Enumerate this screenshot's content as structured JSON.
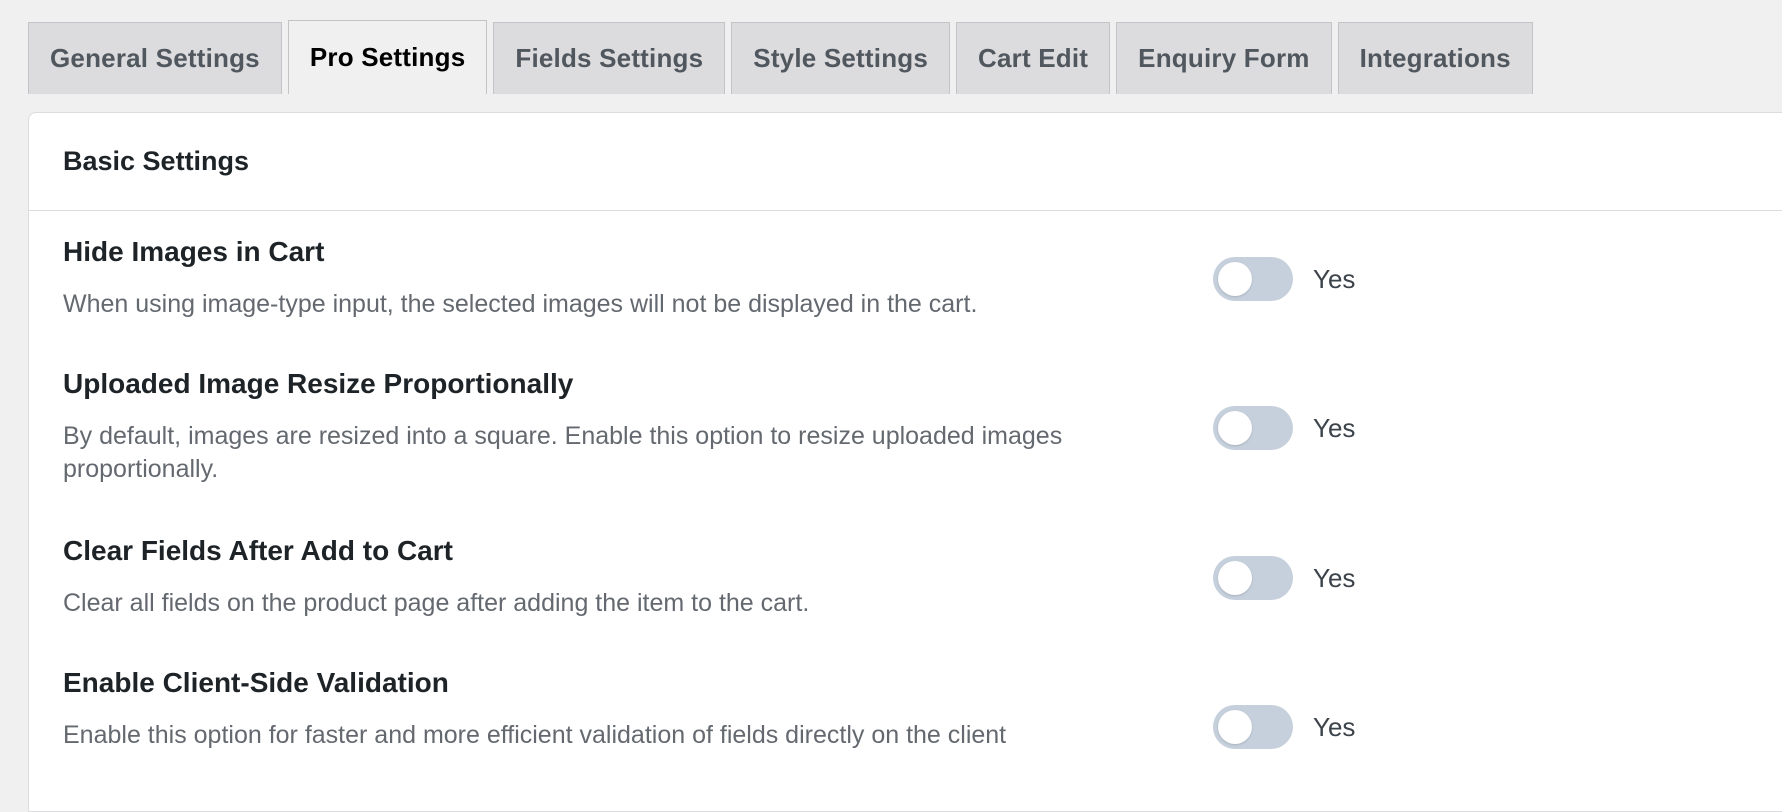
{
  "tabs": [
    {
      "label": "General Settings",
      "active": false
    },
    {
      "label": "Pro Settings",
      "active": true
    },
    {
      "label": "Fields Settings",
      "active": false
    },
    {
      "label": "Style Settings",
      "active": false
    },
    {
      "label": "Cart Edit",
      "active": false
    },
    {
      "label": "Enquiry Form",
      "active": false
    },
    {
      "label": "Integrations",
      "active": false
    }
  ],
  "panel": {
    "title": "Basic Settings",
    "settings": [
      {
        "title": "Hide Images in Cart",
        "description": "When using image-type input, the selected images will not be displayed in the cart.",
        "toggle_label": "Yes",
        "enabled": false
      },
      {
        "title": "Uploaded Image Resize Proportionally",
        "description": "By default, images are resized into a square. Enable this option to resize uploaded images proportionally.",
        "toggle_label": "Yes",
        "enabled": false
      },
      {
        "title": "Clear Fields After Add to Cart",
        "description": "Clear all fields on the product page after adding the item to the cart.",
        "toggle_label": "Yes",
        "enabled": false
      },
      {
        "title": "Enable Client-Side Validation",
        "description": "Enable this option for faster and more efficient validation of fields directly on the client",
        "toggle_label": "Yes",
        "enabled": false
      }
    ]
  },
  "colors": {
    "page_bg": "#f0f0f1",
    "tab_bg": "#dcdcde",
    "toggle_off": "#c5d0dc"
  }
}
